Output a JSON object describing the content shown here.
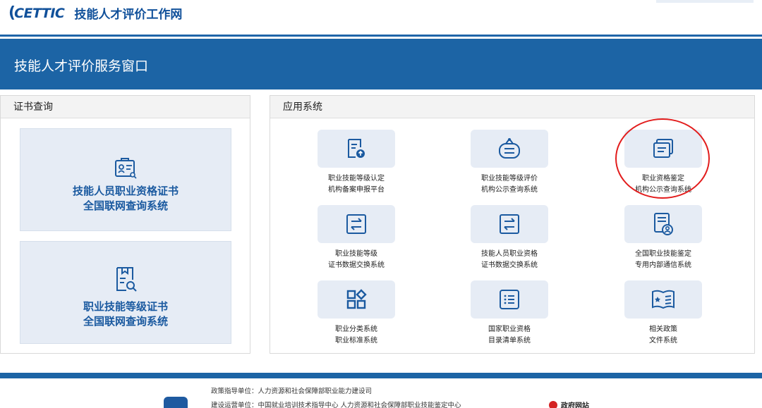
{
  "header": {
    "logo_text": "CETTIC",
    "site_title": "技能人才评价工作网"
  },
  "banner": {
    "title": "技能人才评价服务窗口"
  },
  "cert_panel": {
    "title": "证书查询",
    "cards": [
      {
        "line1": "技能人员职业资格证书",
        "line2": "全国联网查询系统",
        "icon": "certificate-icon"
      },
      {
        "line1": "职业技能等级证书",
        "line2": "全国联网查询系统",
        "icon": "document-search-icon"
      }
    ]
  },
  "apps_panel": {
    "title": "应用系统",
    "apps": [
      {
        "line1": "职业技能等级认定",
        "line2": "机构备案申报平台",
        "icon": "document-upload-icon"
      },
      {
        "line1": "职业技能等级评价",
        "line2": "机构公示查询系统",
        "icon": "notice-board-icon"
      },
      {
        "line1": "职业资格鉴定",
        "line2": "机构公示查询系统",
        "icon": "stacked-documents-icon"
      },
      {
        "line1": "职业技能等级",
        "line2": "证书数据交换系统",
        "icon": "exchange-icon"
      },
      {
        "line1": "技能人员职业资格",
        "line2": "证书数据交换系统",
        "icon": "exchange-icon"
      },
      {
        "line1": "全国职业技能鉴定",
        "line2": "专用内部通信系统",
        "icon": "document-user-icon"
      },
      {
        "line1": "职业分类系统",
        "line2": "职业标准系统",
        "icon": "category-grid-icon"
      },
      {
        "line1": "国家职业资格",
        "line2": "目录清单系统",
        "icon": "list-icon"
      },
      {
        "line1": "相关政策",
        "line2": "文件系统",
        "icon": "policy-book-icon"
      }
    ]
  },
  "footer": {
    "line1": "政策指导单位：人力资源和社会保障部职业能力建设司",
    "line2": "建设运营单位：中国就业培训技术指导中心 人力资源和社会保障部职业技能鉴定中心",
    "gov_label": "政府网站"
  },
  "colors": {
    "brand_blue": "#1c64a5",
    "tile_bg": "#e6ecf5",
    "highlight_red": "#e21d1d"
  }
}
